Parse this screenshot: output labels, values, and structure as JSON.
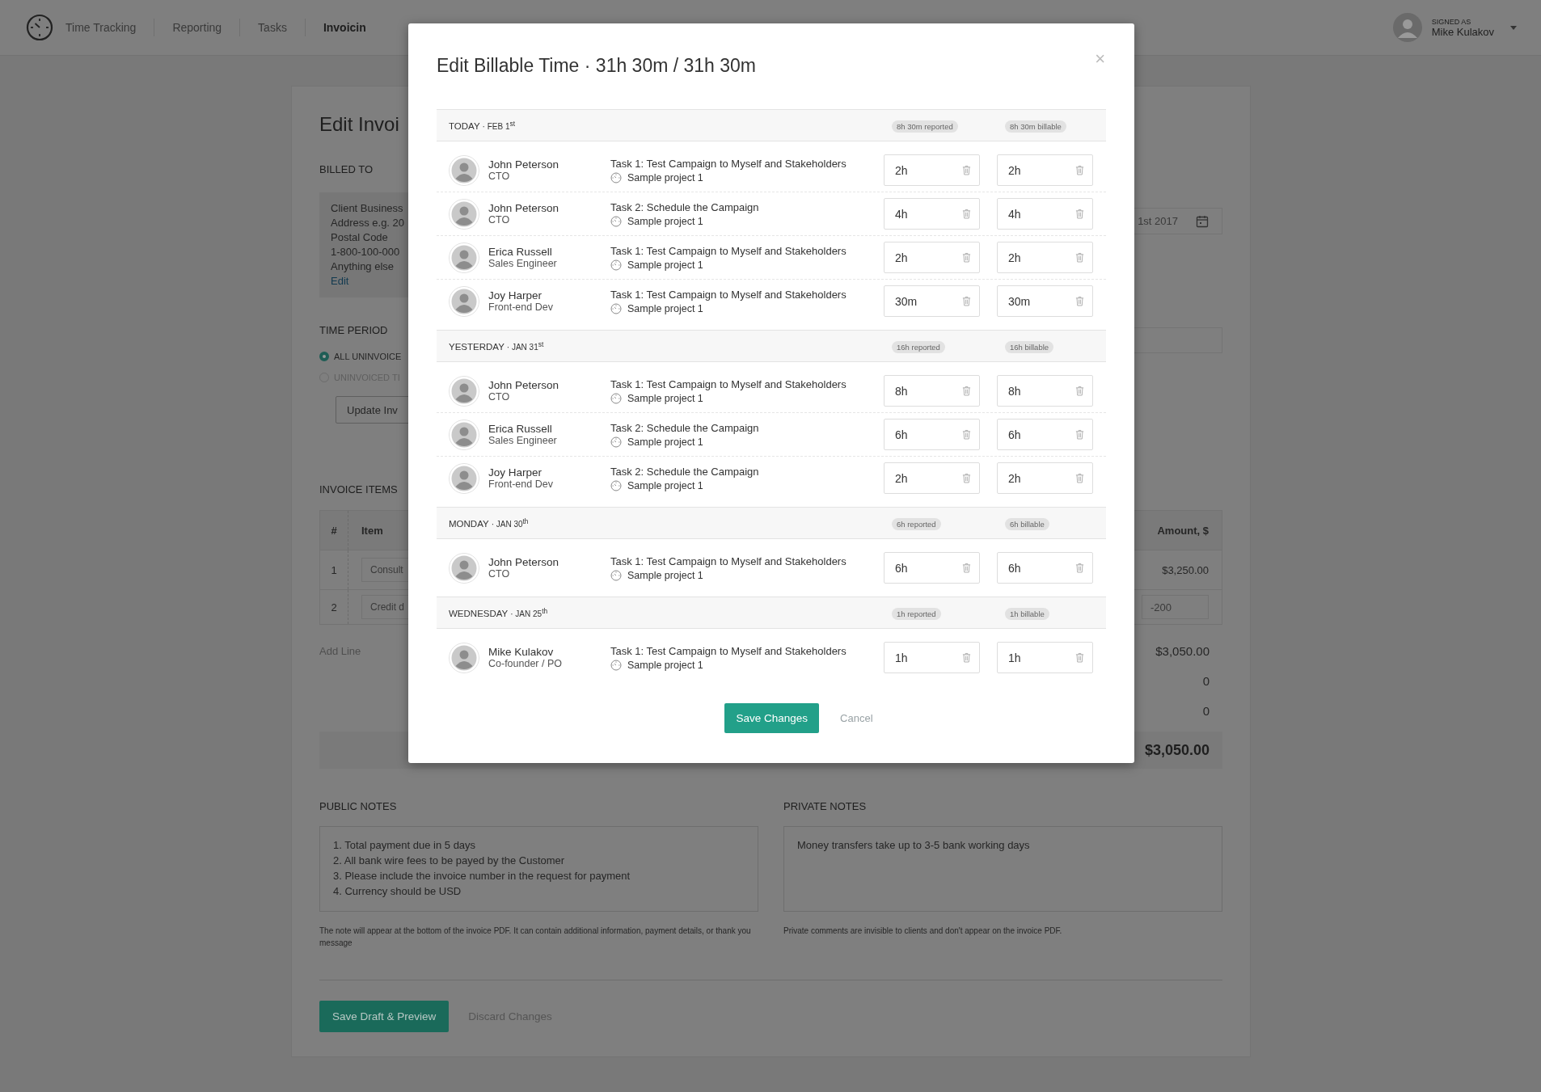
{
  "nav": {
    "items": [
      {
        "label": "Time Tracking",
        "selected": false
      },
      {
        "label": "Reporting",
        "selected": false
      },
      {
        "label": "Tasks",
        "selected": false
      },
      {
        "label": "Invoicin",
        "selected": true
      }
    ],
    "user": {
      "caption": "SIGNED AS",
      "name": "Mike Kulakov"
    }
  },
  "invoice": {
    "title": "Edit Invoi",
    "billed_to": {
      "heading": "BILLED TO",
      "lines": [
        "Client Business",
        "Address e.g. 20",
        "Postal Code",
        "1-800-100-000",
        "Anything else"
      ],
      "link": "Edit"
    },
    "date_field": {
      "value": "1st 2017"
    },
    "time_period": {
      "heading": "TIME PERIOD",
      "options": [
        {
          "label": "ALL UNINVOICE",
          "selected": true
        },
        {
          "label": "UNINVOICED TI",
          "selected": false
        }
      ],
      "button": "Update Inv"
    },
    "items": {
      "heading": "INVOICE ITEMS",
      "columns": [
        "#",
        "Item",
        "Amount, $"
      ],
      "rows": [
        {
          "number": "1",
          "item": "Consult",
          "amount": "$3,250.00",
          "kind": "text"
        },
        {
          "number": "2",
          "item": "Credit d",
          "amount": "-200",
          "kind": "field"
        }
      ],
      "add_line": "Add Line"
    },
    "subtotals": [
      "$3,050.00",
      "0",
      "0"
    ],
    "total": "$3,050.00",
    "notes": [
      {
        "heading": "PUBLIC NOTES",
        "lines": [
          "1. Total payment due in 5 days",
          "2. All bank wire fees to be payed by the Customer",
          "3. Please include the invoice number in the request for payment",
          "4. Currency should be USD"
        ],
        "hint": "The note will appear at the bottom of the invoice PDF. It can contain additional information, payment details, or thank you message"
      },
      {
        "heading": "PRIVATE NOTES",
        "lines": [
          "Money transfers take up to 3-5 bank working days"
        ],
        "hint": "Private comments are invisible to clients and don't appear on the invoice PDF."
      }
    ],
    "buttons": {
      "primary": "Save Draft & Preview",
      "secondary": "Discard Changes"
    }
  },
  "modal": {
    "title": "Edit Billable Time · 31h 30m / 31h 30m",
    "close": "×",
    "days": [
      {
        "day": "TODAY",
        "date": "· FEB 1$^{st}$",
        "reported": "8h 30m reported",
        "billable": "8h 30m billable",
        "entries": [
          {
            "name": "John Peterson",
            "role": "CTO",
            "task": "Task 1: Test Campaign to Myself and Stakeholders",
            "project": "Sample project 1",
            "reported": "2h",
            "billable": "2h"
          },
          {
            "name": "John Peterson",
            "role": "CTO",
            "task": "Task 2: Schedule the Campaign",
            "project": "Sample project 1",
            "reported": "4h",
            "billable": "4h"
          },
          {
            "name": "Erica Russell",
            "role": "Sales Engineer",
            "task": "Task 1: Test Campaign to Myself and Stakeholders",
            "project": "Sample project 1",
            "reported": "2h",
            "billable": "2h"
          },
          {
            "name": "Joy Harper",
            "role": "Front-end Dev",
            "task": "Task 1: Test Campaign to Myself and Stakeholders",
            "project": "Sample project 1",
            "reported": "30m",
            "billable": "30m"
          }
        ]
      },
      {
        "day": "YESTERDAY",
        "date": "· JAN 31$^{st}$",
        "reported": "16h reported",
        "billable": "16h billable",
        "entries": [
          {
            "name": "John Peterson",
            "role": "CTO",
            "task": "Task 1: Test Campaign to Myself and Stakeholders",
            "project": "Sample project 1",
            "reported": "8h",
            "billable": "8h"
          },
          {
            "name": "Erica Russell",
            "role": "Sales Engineer",
            "task": "Task 2: Schedule the Campaign",
            "project": "Sample project 1",
            "reported": "6h",
            "billable": "6h"
          },
          {
            "name": "Joy Harper",
            "role": "Front-end Dev",
            "task": "Task 2: Schedule the Campaign",
            "project": "Sample project 1",
            "reported": "2h",
            "billable": "2h"
          }
        ]
      },
      {
        "day": "MONDAY",
        "date": "· JAN 30$^{th}$",
        "reported": "6h reported",
        "billable": "6h billable",
        "entries": [
          {
            "name": "John Peterson",
            "role": "CTO",
            "task": "Task 1: Test Campaign to Myself and Stakeholders",
            "project": "Sample project 1",
            "reported": "6h",
            "billable": "6h"
          }
        ]
      },
      {
        "day": "WEDNESDAY",
        "date": "· JAN 25$^{th}$",
        "reported": "1h reported",
        "billable": "1h billable",
        "entries": [
          {
            "name": "Mike Kulakov",
            "role": "Co-founder / PO",
            "task": "Task 1: Test Campaign to Myself and Stakeholders",
            "project": "Sample project 1",
            "reported": "1h",
            "billable": "1h"
          }
        ]
      }
    ],
    "buttons": {
      "save": "Save Changes",
      "cancel": "Cancel"
    }
  }
}
